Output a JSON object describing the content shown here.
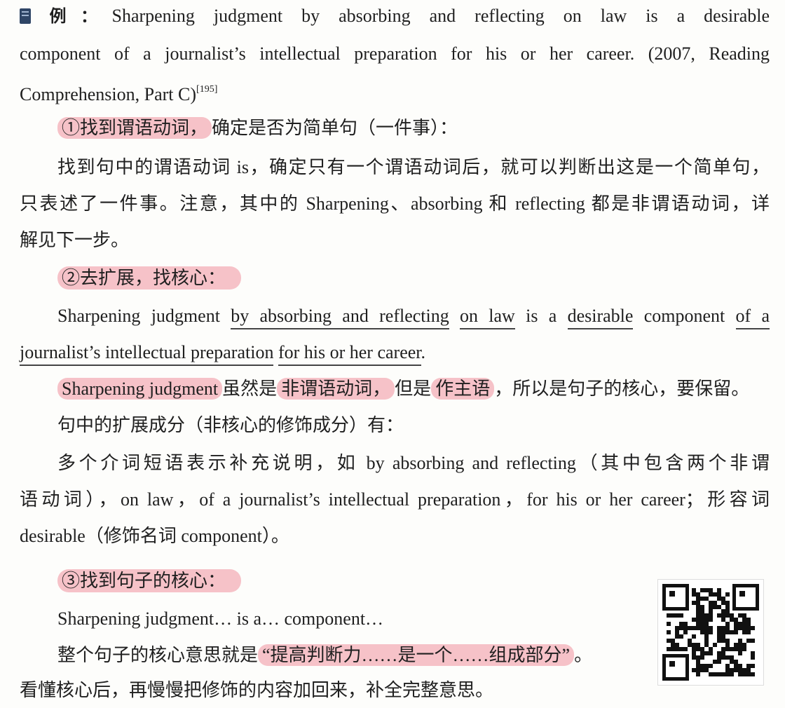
{
  "example": {
    "label": "例：",
    "sentence_1": "Sharpening judgment by absorbing and reflecting on law is a desirable",
    "sentence_2": "component of a journalist’s intellectual preparation for his or her career. (2007, Reading",
    "sentence_3": "Comprehension, Part C)",
    "footnote": "[195]"
  },
  "step1": {
    "heading": "①找到谓语动词，",
    "heading_rest": "确定是否为简单句（一件事）：",
    "para_line1": "找到句中的谓语动词 is，确定只有一个谓语动词后，就可以判断出这是一个简单句，",
    "para_line2": "只表述了一件事。注意，其中的 Sharpening、absorbing 和 reflecting 都是非谓语动词，详",
    "para_line3": "解见下一步。"
  },
  "step2": {
    "heading": "②去扩展，找核心：",
    "s_a": "Sharpening judgment ",
    "s_b": "by absorbing and reflecting",
    "s_c": " ",
    "s_d": "on law",
    "s_e": " is a ",
    "s_f": "desirable",
    "s_g": " component ",
    "s_h": "of a",
    "s_i": "journalist’s intellectual preparation",
    "s_j": " ",
    "s_k": "for his or her career",
    "s_l": ".",
    "core_subject": "Sharpening judgment",
    "c_1": "虽然是",
    "c_2": "非谓语动词，",
    "c_3": "但是",
    "c_4": "作主语",
    "c_5": "，所以是句子的核心，要保留。",
    "ext_intro": "句中的扩展成分（非核心的修饰成分）有：",
    "ext_line1": "多个介词短语表示补充说明，如 by absorbing and reflecting（其中包含两个非谓",
    "ext_line2": "语动词），on law，of a journalist’s intellectual preparation，for his or her career；形容词",
    "ext_line3": "desirable（修饰名词 component）。"
  },
  "step3": {
    "heading": "③找到句子的核心：",
    "core": "Sharpening judgment… is a… component…",
    "meaning_pre": "整个句子的核心意思就是",
    "meaning_hl": "“提高判断力……是一个……组成部分”",
    "meaning_post": "。",
    "final": "看懂核心后，再慢慢把修饰的内容加回来，补全完整意思。"
  },
  "icons": {
    "label_icon": "book-icon",
    "qr": "qr-code"
  },
  "colors": {
    "highlight": "#f6c2c8",
    "label_icon": "#2f4566"
  }
}
